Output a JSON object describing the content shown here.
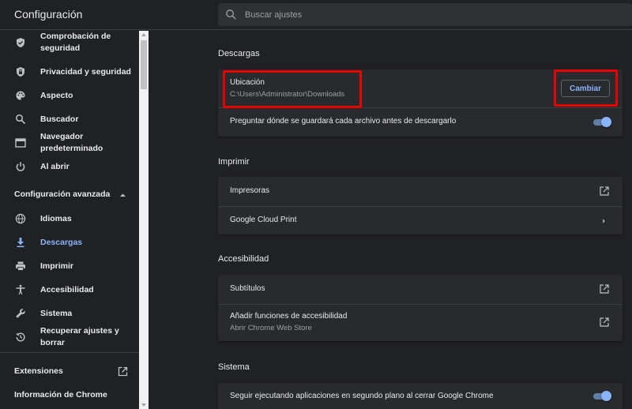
{
  "app": {
    "title": "Configuración"
  },
  "search": {
    "placeholder": "Buscar ajustes",
    "icon": "search-icon"
  },
  "sidebar": {
    "items": [
      {
        "label": "Comprobación de seguridad",
        "icon": "shield-check-icon"
      },
      {
        "label": "Privacidad y seguridad",
        "icon": "shield-lock-icon"
      },
      {
        "label": "Aspecto",
        "icon": "palette-icon"
      },
      {
        "label": "Buscador",
        "icon": "search-icon"
      },
      {
        "label": "Navegador predeterminado",
        "icon": "browser-window-icon"
      },
      {
        "label": "Al abrir",
        "icon": "power-icon"
      }
    ],
    "advanced_label": "Configuración avanzada",
    "advanced_items": [
      {
        "label": "Idiomas",
        "icon": "globe-icon"
      },
      {
        "label": "Descargas",
        "icon": "download-icon",
        "active": true
      },
      {
        "label": "Imprimir",
        "icon": "printer-icon"
      },
      {
        "label": "Accesibilidad",
        "icon": "accessibility-icon"
      },
      {
        "label": "Sistema",
        "icon": "wrench-icon"
      },
      {
        "label": "Recuperar ajustes y borrar",
        "icon": "restore-icon"
      }
    ],
    "extensions_label": "Extensiones",
    "about_label": "Información de Chrome"
  },
  "downloads": {
    "title": "Descargas",
    "location_label": "Ubicación",
    "location_path": "C:\\Users\\Administrator\\Downloads",
    "change_button": "Cambiar",
    "ask_label": "Preguntar dónde se guardará cada archivo antes de descargarlo",
    "ask_enabled": true
  },
  "print": {
    "title": "Imprimir",
    "printers_label": "Impresoras",
    "cloud_print_label": "Google Cloud Print"
  },
  "accessibility": {
    "title": "Accesibilidad",
    "captions_label": "Subtítulos",
    "add_features_label": "Añadir funciones de accesibilidad",
    "add_features_sub": "Abrir Chrome Web Store"
  },
  "system": {
    "title": "Sistema",
    "background_label": "Seguir ejecutando aplicaciones en segundo plano al cerrar Google Chrome",
    "background_enabled": true
  },
  "colors": {
    "background": "#202124",
    "card": "#292a2d",
    "accent": "#8ab4f8",
    "highlight": "#e60000"
  }
}
